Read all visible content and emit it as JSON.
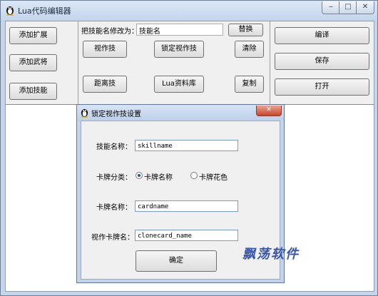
{
  "window": {
    "title": "Lua代码编辑器",
    "controls": {
      "minimize": "‒",
      "maximize": "□",
      "close": "✕"
    }
  },
  "left_panel": {
    "buttons": [
      "添加扩展",
      "添加武将",
      "添加技能"
    ]
  },
  "middle_panel": {
    "rename_label": "把技能名修改为：",
    "rename_value": "技能名",
    "replace_button": "替换",
    "row1": [
      "视作技",
      "锁定视作技",
      "清除"
    ],
    "row2": [
      "距离技",
      "Lua资料库",
      "复制"
    ]
  },
  "right_panel": {
    "buttons": [
      "编译",
      "保存",
      "打开"
    ]
  },
  "dialog": {
    "title": "锁定视作技设置",
    "close_label": "✕",
    "skill_name_label": "技能名称：",
    "skill_name_value": "skillname",
    "card_category_label": "卡牌分类：",
    "radio_card_name": "卡牌名称",
    "radio_card_suit": "卡牌花色",
    "card_name_label": "卡牌名称：",
    "card_name_value": "cardname",
    "view_as_label": "视作卡牌名：",
    "view_as_value": "clonecard_name",
    "ok_button": "确定"
  },
  "watermark": "飘荡软件"
}
